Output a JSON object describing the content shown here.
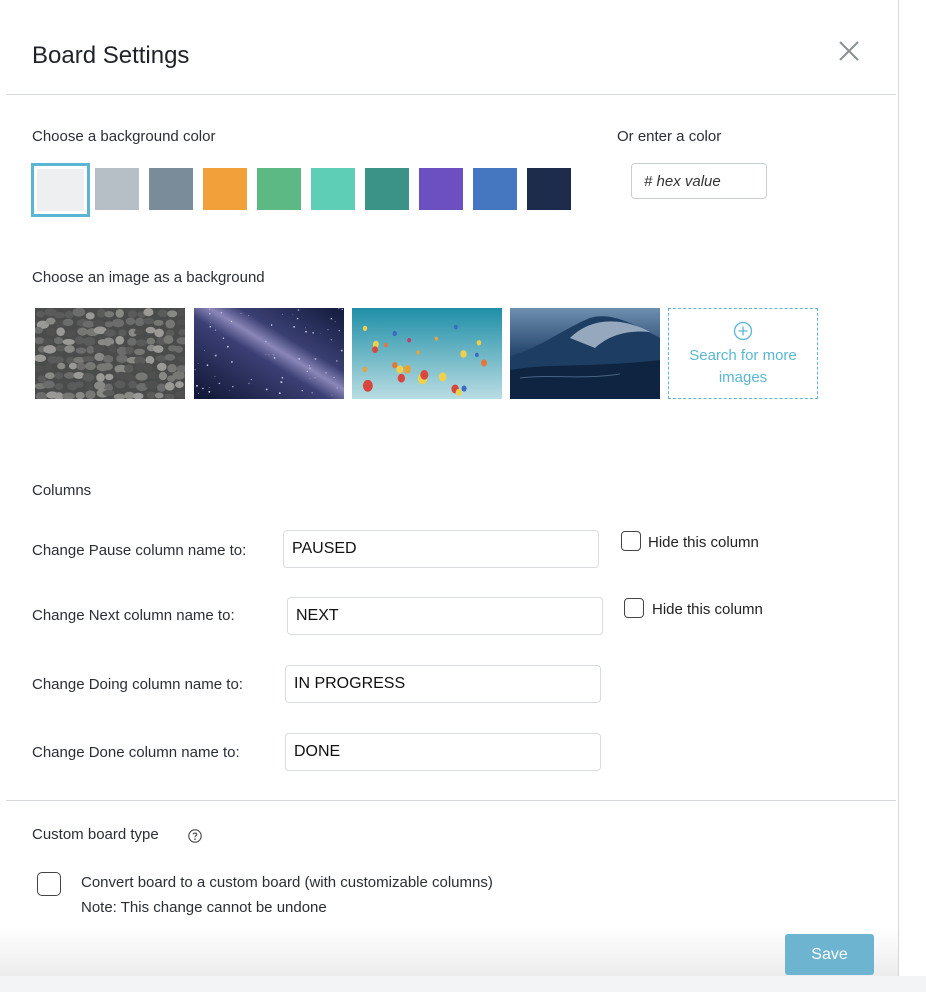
{
  "dialog": {
    "title": "Board Settings"
  },
  "background": {
    "color_label": "Choose a background color",
    "enter_color_label": "Or enter a color",
    "hex_placeholder": "# hex value",
    "swatches": [
      "#edeff1",
      "#b5bfc5",
      "#7a8c99",
      "#f2a13a",
      "#5cb983",
      "#5ecfb6",
      "#3a9386",
      "#6c4fc0",
      "#4477c0",
      "#1d2b4d"
    ],
    "selected_swatch": 0,
    "image_label": "Choose an image as a background",
    "images": [
      "pebbles",
      "milky-way",
      "hot-air-balloons",
      "ocean-wave"
    ],
    "more_images_label": "Search for more images",
    "accent_color": "#5bb6d4"
  },
  "columns": {
    "heading": "Columns",
    "rows": [
      {
        "label": "Change Pause column name to:",
        "value": "PAUSED",
        "hide_label": "Hide this column",
        "hide_checked": false
      },
      {
        "label": "Change Next column name to:",
        "value": "NEXT",
        "hide_label": "Hide this column",
        "hide_checked": false
      },
      {
        "label": "Change Doing column name to:",
        "value": "IN PROGRESS"
      },
      {
        "label": "Change Done column name to:",
        "value": "DONE"
      }
    ]
  },
  "custom": {
    "heading": "Custom board type",
    "convert_label": "Convert board to a custom board (with customizable columns)",
    "note": "Note: This change cannot be undone",
    "checked": false
  },
  "footer": {
    "save_label": "Save",
    "save_color": "#6cb4cf"
  }
}
